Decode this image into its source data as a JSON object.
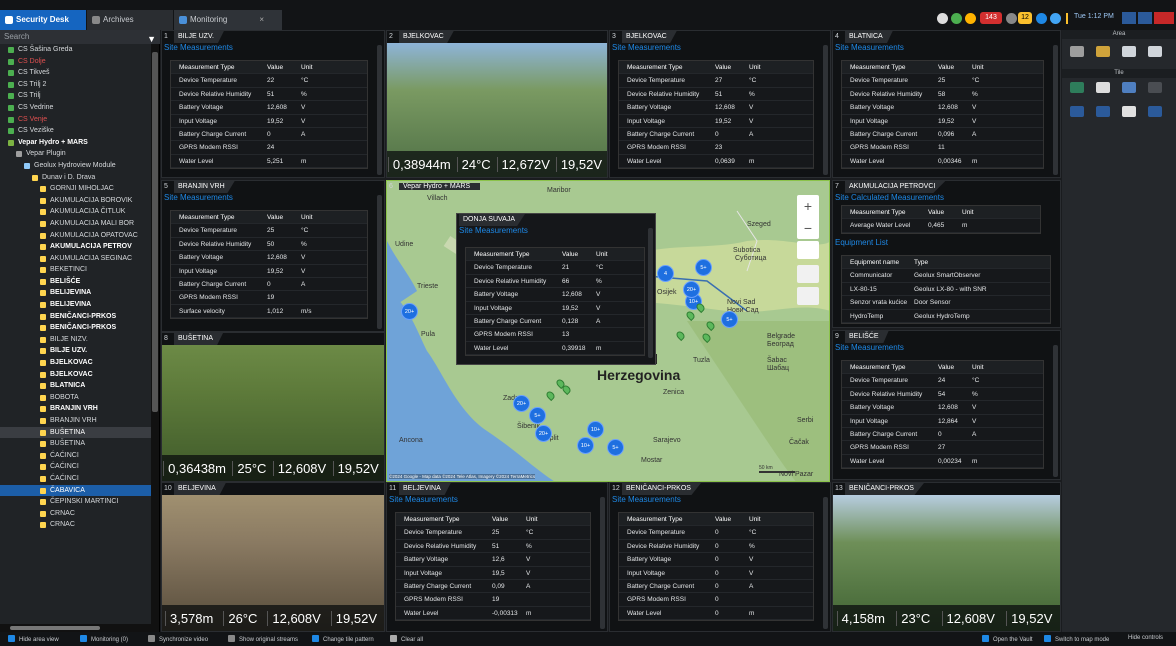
{
  "tabs": [
    {
      "label": "Security Desk"
    },
    {
      "label": "Archives"
    },
    {
      "label": "Monitoring"
    }
  ],
  "tray": {
    "badge1": "143",
    "badge2": "12",
    "time": "Tue 1:12 PM"
  },
  "search": {
    "placeholder": "Search"
  },
  "tree": [
    {
      "label": "CS Šašina Greda",
      "indent": 8,
      "color": "#4caf50",
      "style": ""
    },
    {
      "label": "CS Dolje",
      "indent": 8,
      "color": "#4caf50",
      "style": "red"
    },
    {
      "label": "CS Tikveš",
      "indent": 8,
      "color": "#4caf50",
      "style": ""
    },
    {
      "label": "CS Trilj 2",
      "indent": 8,
      "color": "#4caf50",
      "style": ""
    },
    {
      "label": "CS Trilj",
      "indent": 8,
      "color": "#4caf50",
      "style": ""
    },
    {
      "label": "CS Vedrine",
      "indent": 8,
      "color": "#4caf50",
      "style": ""
    },
    {
      "label": "CS Venje",
      "indent": 8,
      "color": "#4caf50",
      "style": "red"
    },
    {
      "label": "CS Veziške",
      "indent": 8,
      "color": "#4caf50",
      "style": ""
    },
    {
      "label": "Vepar Hydro + MARS",
      "indent": 8,
      "color": "#7cb342",
      "style": "bold"
    },
    {
      "label": "Vepar Plugin",
      "indent": 16,
      "color": "#9e9e9e",
      "style": ""
    },
    {
      "label": "Geolux Hydroview Module",
      "indent": 24,
      "color": "#90caf9",
      "style": ""
    },
    {
      "label": "Dunav i D. Drava",
      "indent": 32,
      "color": "#ffd54f",
      "style": ""
    },
    {
      "label": "GORNJI MIHOLJAC",
      "indent": 40,
      "color": "#ffd54f",
      "style": ""
    },
    {
      "label": "AKUMULACIJA BOROVIK",
      "indent": 40,
      "color": "#ffd54f",
      "style": ""
    },
    {
      "label": "AKUMULACIJA ČITLUK",
      "indent": 40,
      "color": "#ffd54f",
      "style": ""
    },
    {
      "label": "AKUMULACIJA MALI BOR",
      "indent": 40,
      "color": "#ffd54f",
      "style": ""
    },
    {
      "label": "AKUMULACIJA OPATOVAC",
      "indent": 40,
      "color": "#ffd54f",
      "style": ""
    },
    {
      "label": "AKUMULACIJA PETROV",
      "indent": 40,
      "color": "#ffd54f",
      "style": "bold"
    },
    {
      "label": "AKUMULACIJA SEGINAC",
      "indent": 40,
      "color": "#ffd54f",
      "style": ""
    },
    {
      "label": "BEKETINCI",
      "indent": 40,
      "color": "#ffd54f",
      "style": ""
    },
    {
      "label": "BELIŠĆE",
      "indent": 40,
      "color": "#ffd54f",
      "style": "bold"
    },
    {
      "label": "BELIJEVINA",
      "indent": 40,
      "color": "#ffd54f",
      "style": "bold"
    },
    {
      "label": "BELIJEVINA",
      "indent": 40,
      "color": "#ffd54f",
      "style": "bold"
    },
    {
      "label": "BENIČANCI-PRKOS",
      "indent": 40,
      "color": "#ffd54f",
      "style": "bold"
    },
    {
      "label": "BENIČANCI-PRKOS",
      "indent": 40,
      "color": "#ffd54f",
      "style": "bold"
    },
    {
      "label": "BILJE NIZV.",
      "indent": 40,
      "color": "#ffd54f",
      "style": ""
    },
    {
      "label": "BILJE UZV.",
      "indent": 40,
      "color": "#ffd54f",
      "style": "bold"
    },
    {
      "label": "BJELKOVAC",
      "indent": 40,
      "color": "#ffd54f",
      "style": "bold"
    },
    {
      "label": "BJELKOVAC",
      "indent": 40,
      "color": "#ffd54f",
      "style": "bold"
    },
    {
      "label": "BLATNICA",
      "indent": 40,
      "color": "#ffd54f",
      "style": "bold"
    },
    {
      "label": "BOBOTA",
      "indent": 40,
      "color": "#ffd54f",
      "style": ""
    },
    {
      "label": "BRANJIN VRH",
      "indent": 40,
      "color": "#ffd54f",
      "style": "bold"
    },
    {
      "label": "BRANJIN VRH",
      "indent": 40,
      "color": "#ffd54f",
      "style": ""
    },
    {
      "label": "BUŠETINA",
      "indent": 40,
      "color": "#ffd54f",
      "style": "hl"
    },
    {
      "label": "BUŠETINA",
      "indent": 40,
      "color": "#ffd54f",
      "style": ""
    },
    {
      "label": "ĆAĆINCI",
      "indent": 40,
      "color": "#ffd54f",
      "style": ""
    },
    {
      "label": "ĆAĆINCI",
      "indent": 40,
      "color": "#ffd54f",
      "style": ""
    },
    {
      "label": "ĆAĆINCI",
      "indent": 40,
      "color": "#ffd54f",
      "style": ""
    },
    {
      "label": "ČABAVICA",
      "indent": 40,
      "color": "#ffd54f",
      "style": "sel"
    },
    {
      "label": "ČEPINSKI MARTINCI",
      "indent": 40,
      "color": "#ffd54f",
      "style": ""
    },
    {
      "label": "CRNAC",
      "indent": 40,
      "color": "#ffd54f",
      "style": ""
    },
    {
      "label": "CRNAC",
      "indent": 40,
      "color": "#ffd54f",
      "style": ""
    }
  ],
  "common": {
    "site_measurements": "Site Measurements",
    "col_type": "Measurement Type",
    "col_value": "Value",
    "col_unit": "Unit"
  },
  "tiles": [
    {
      "num": "1",
      "name": "BILJE UZV.",
      "rows": [
        [
          "Device Temperature",
          "22",
          "°C"
        ],
        [
          "Device Relative Humidity",
          "51",
          "%"
        ],
        [
          "Battery Voltage",
          "12,608",
          "V"
        ],
        [
          "Input Voltage",
          "19,52",
          "V"
        ],
        [
          "Battery Charge Current",
          "0",
          "A"
        ],
        [
          "GPRS Modem RSSI",
          "24",
          ""
        ],
        [
          "Water Level",
          "5,251",
          "m"
        ]
      ]
    },
    {
      "num": "2",
      "name": "BJELKOVAC",
      "overlay": [
        "0,38944m",
        "24°C",
        "12,672V",
        "19,52V"
      ]
    },
    {
      "num": "3",
      "name": "BJELKOVAC",
      "rows": [
        [
          "Device Temperature",
          "27",
          "°C"
        ],
        [
          "Device Relative Humidity",
          "51",
          "%"
        ],
        [
          "Battery Voltage",
          "12,608",
          "V"
        ],
        [
          "Input Voltage",
          "19,52",
          "V"
        ],
        [
          "Battery Charge Current",
          "0",
          "A"
        ],
        [
          "GPRS Modem RSSI",
          "23",
          ""
        ],
        [
          "Water Level",
          "0,0639",
          "m"
        ]
      ]
    },
    {
      "num": "4",
      "name": "BLATNICA",
      "rows": [
        [
          "Device Temperature",
          "25",
          "°C"
        ],
        [
          "Device Relative Humidity",
          "58",
          "%"
        ],
        [
          "Battery Voltage",
          "12,608",
          "V"
        ],
        [
          "Input Voltage",
          "19,52",
          "V"
        ],
        [
          "Battery Charge Current",
          "0,096",
          "A"
        ],
        [
          "GPRS Modem RSSI",
          "11",
          ""
        ],
        [
          "Water Level",
          "0,00346",
          "m"
        ]
      ]
    },
    {
      "num": "5",
      "name": "BRANJIN VRH",
      "rows": [
        [
          "Device Temperature",
          "25",
          "°C"
        ],
        [
          "Device Relative Humidity",
          "50",
          "%"
        ],
        [
          "Battery Voltage",
          "12,608",
          "V"
        ],
        [
          "Input Voltage",
          "19,52",
          "V"
        ],
        [
          "Battery Charge Current",
          "0",
          "A"
        ],
        [
          "GPRS Modem RSSI",
          "19",
          ""
        ],
        [
          "Surface velocity",
          "1,012",
          "m/s"
        ]
      ]
    },
    {
      "num": "6",
      "name": "Vepar Hydro + MARS"
    },
    {
      "num": "7",
      "name": "AKUMULACIJA PETROVCI",
      "calc_label": "Site Calculated Measurements",
      "calc_rows": [
        [
          "Average Water Level",
          "0,465",
          "m"
        ]
      ],
      "equip_label": "Equipment List",
      "equip_cols": [
        "Equipment name",
        "Type"
      ],
      "equip_rows": [
        [
          "Communicator",
          "Geolux SmartObserver"
        ],
        [
          "LX-80-15",
          "Geolux LX-80 - with SNR"
        ],
        [
          "Senzor vrata kućice",
          "Door Sensor"
        ],
        [
          "HydroTemp",
          "Geolux HydroTemp"
        ]
      ]
    },
    {
      "num": "8",
      "name": "BUŠETINA",
      "overlay": [
        "0,36438m",
        "25°C",
        "12,608V",
        "19,52V"
      ]
    },
    {
      "num": "9",
      "name": "BELIŠĆE",
      "rows": [
        [
          "Device Temperature",
          "24",
          "°C"
        ],
        [
          "Device Relative Humidity",
          "54",
          "%"
        ],
        [
          "Battery Voltage",
          "12,608",
          "V"
        ],
        [
          "Input Voltage",
          "12,864",
          "V"
        ],
        [
          "Battery Charge Current",
          "0",
          "A"
        ],
        [
          "GPRS Modem RSSI",
          "27",
          ""
        ],
        [
          "Water Level",
          "0,00234",
          "m"
        ]
      ]
    },
    {
      "num": "10",
      "name": "BELJEVINA",
      "overlay": [
        "3,578m",
        "26°C",
        "12,608V",
        "19,52V"
      ]
    },
    {
      "num": "11",
      "name": "BELJEVINA",
      "rows": [
        [
          "Device Temperature",
          "25",
          "°C"
        ],
        [
          "Device Relative Humidity",
          "51",
          "%"
        ],
        [
          "Battery Voltage",
          "12,6",
          "V"
        ],
        [
          "Input Voltage",
          "19,5",
          "V"
        ],
        [
          "Battery Charge Current",
          "0,09",
          "A"
        ],
        [
          "GPRS Modem RSSI",
          "19",
          ""
        ],
        [
          "Water Level",
          "-0,00313",
          "m"
        ]
      ]
    },
    {
      "num": "12",
      "name": "BENIČANCI-PRKOS",
      "rows": [
        [
          "Device Temperature",
          "0",
          "°C"
        ],
        [
          "Device Relative Humidity",
          "0",
          "%"
        ],
        [
          "Battery Voltage",
          "0",
          "V"
        ],
        [
          "Input Voltage",
          "0",
          "V"
        ],
        [
          "Battery Charge Current",
          "0",
          "A"
        ],
        [
          "GPRS Modem RSSI",
          "0",
          ""
        ],
        [
          "Water Level",
          "0",
          "m"
        ]
      ]
    },
    {
      "num": "13",
      "name": "BENIČANCI-PRKOS",
      "overlay": [
        "4,158m",
        "23°C",
        "12,608V",
        "19,52V"
      ]
    }
  ],
  "popup": {
    "name": "DONJA SUVAJA",
    "rows": [
      [
        "Device Temperature",
        "21",
        "°C"
      ],
      [
        "Device Relative Humidity",
        "66",
        "%"
      ],
      [
        "Battery Voltage",
        "12,608",
        "V"
      ],
      [
        "Input Voltage",
        "19,52",
        "V"
      ],
      [
        "Battery Charge Current",
        "0,128",
        "A"
      ],
      [
        "GPRS Modem RSSI",
        "13",
        ""
      ],
      [
        "Water Level",
        "0,39918",
        "m"
      ]
    ]
  },
  "map": {
    "labels": [
      "Villach",
      "Maribor",
      "Udine",
      "Pécs",
      "Szeged",
      "Subotica",
      "Суботица",
      "Trieste",
      "Osijek",
      "Novi Sad",
      "Нови Сад",
      "Pula",
      "Zadar",
      "Šibenik",
      "Split",
      "Belgrade",
      "Београд",
      "Sarajevo",
      "Mostar",
      "Ancona",
      "Zenica",
      "Tuzla",
      "Šabac",
      "Шабац",
      "Serbi",
      "Čačak",
      "Novi Pazar",
      "Herzegovina",
      "and"
    ],
    "attribution": "©2024 Google - Map data ©2024 Tele Atlas, Imagery ©2024 TerraMetrics",
    "scale": "50 km",
    "pins": [
      "4",
      "5+",
      "20+",
      "10+",
      "5+",
      "20+",
      "20+",
      "5+",
      "20+",
      "10+",
      "10+",
      "5+"
    ]
  },
  "right_pane": {
    "area": "Area",
    "tile": "Tile"
  },
  "bottom": [
    {
      "label": "Hide area view"
    },
    {
      "label": "Monitoring (0)"
    },
    {
      "label": "Synchronize video"
    },
    {
      "label": "Show original streams"
    },
    {
      "label": "Change tile pattern"
    },
    {
      "label": "Clear all"
    },
    {
      "label": "Open the Vault"
    },
    {
      "label": "Switch to map mode"
    },
    {
      "label": "Hide controls"
    }
  ]
}
